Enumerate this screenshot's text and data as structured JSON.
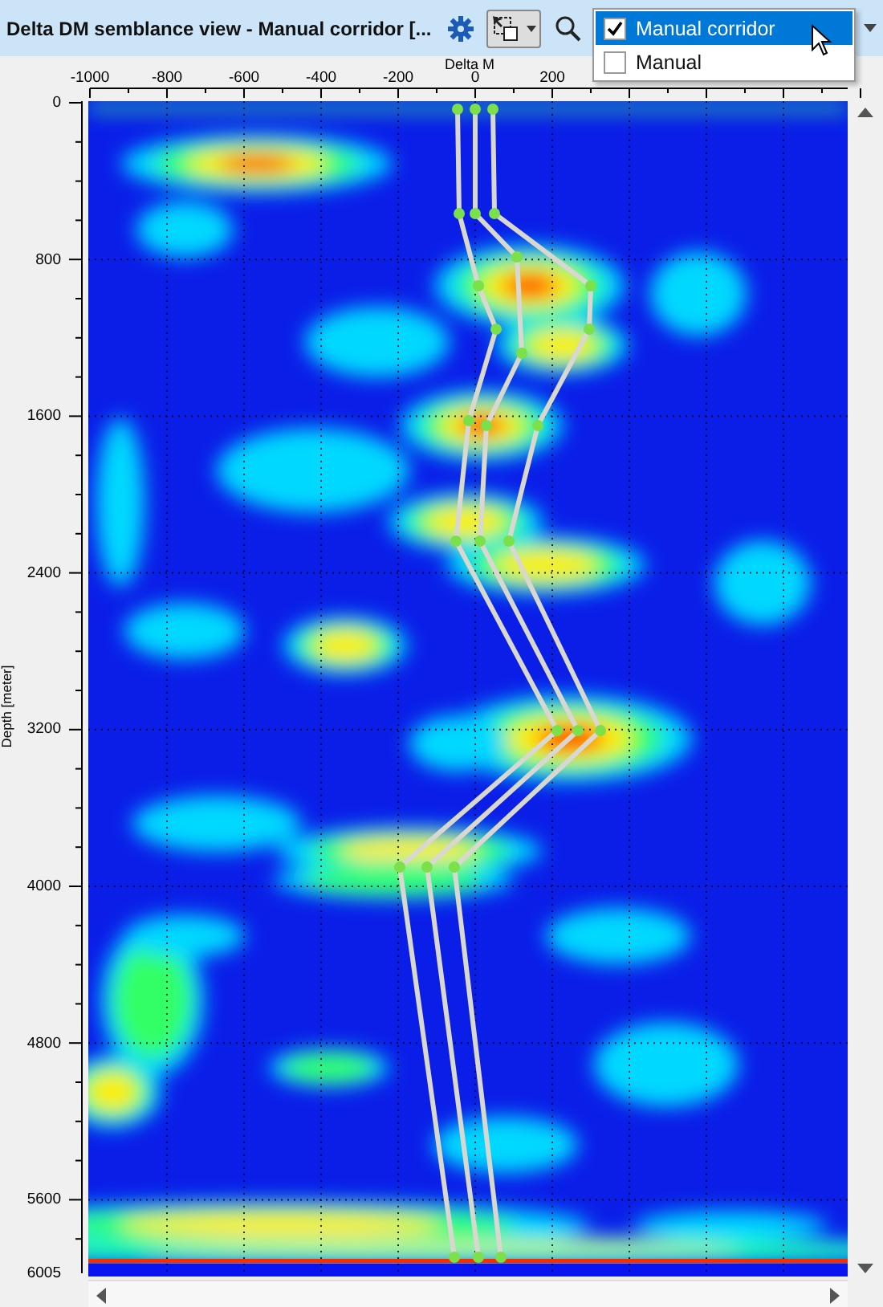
{
  "window": {
    "title": "Delta DM semblance view - Manual corridor [..."
  },
  "menu": {
    "items": [
      {
        "label": "Manual corridor",
        "checked": true,
        "selected": true
      },
      {
        "label": "Manual",
        "checked": false,
        "selected": false
      }
    ]
  },
  "plot": {
    "x_axis": {
      "title": "Delta M",
      "ticks": [
        "-1000",
        "-800",
        "-600",
        "-400",
        "-200",
        "0",
        "200"
      ]
    },
    "y_axis": {
      "title": "Depth [meter]",
      "ticks": [
        "0",
        "800",
        "1600",
        "2400",
        "3200",
        "4000",
        "4800",
        "5600",
        "6005"
      ]
    }
  }
}
